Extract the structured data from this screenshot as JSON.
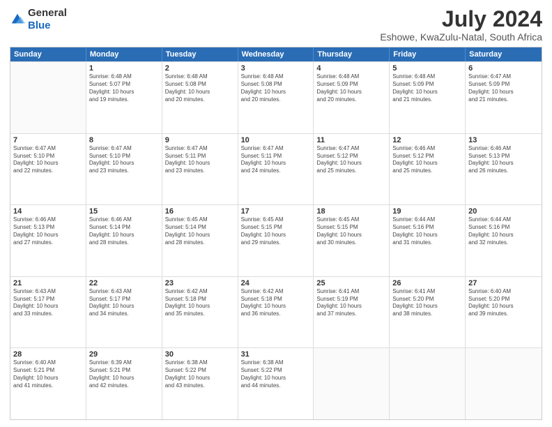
{
  "logo": {
    "general": "General",
    "blue": "Blue"
  },
  "title": "July 2024",
  "subtitle": "Eshowe, KwaZulu-Natal, South Africa",
  "days_of_week": [
    "Sunday",
    "Monday",
    "Tuesday",
    "Wednesday",
    "Thursday",
    "Friday",
    "Saturday"
  ],
  "weeks": [
    [
      {
        "day": "",
        "info": ""
      },
      {
        "day": "1",
        "info": "Sunrise: 6:48 AM\nSunset: 5:07 PM\nDaylight: 10 hours\nand 19 minutes."
      },
      {
        "day": "2",
        "info": "Sunrise: 6:48 AM\nSunset: 5:08 PM\nDaylight: 10 hours\nand 20 minutes."
      },
      {
        "day": "3",
        "info": "Sunrise: 6:48 AM\nSunset: 5:08 PM\nDaylight: 10 hours\nand 20 minutes."
      },
      {
        "day": "4",
        "info": "Sunrise: 6:48 AM\nSunset: 5:09 PM\nDaylight: 10 hours\nand 20 minutes."
      },
      {
        "day": "5",
        "info": "Sunrise: 6:48 AM\nSunset: 5:09 PM\nDaylight: 10 hours\nand 21 minutes."
      },
      {
        "day": "6",
        "info": "Sunrise: 6:47 AM\nSunset: 5:09 PM\nDaylight: 10 hours\nand 21 minutes."
      }
    ],
    [
      {
        "day": "7",
        "info": "Sunrise: 6:47 AM\nSunset: 5:10 PM\nDaylight: 10 hours\nand 22 minutes."
      },
      {
        "day": "8",
        "info": "Sunrise: 6:47 AM\nSunset: 5:10 PM\nDaylight: 10 hours\nand 23 minutes."
      },
      {
        "day": "9",
        "info": "Sunrise: 6:47 AM\nSunset: 5:11 PM\nDaylight: 10 hours\nand 23 minutes."
      },
      {
        "day": "10",
        "info": "Sunrise: 6:47 AM\nSunset: 5:11 PM\nDaylight: 10 hours\nand 24 minutes."
      },
      {
        "day": "11",
        "info": "Sunrise: 6:47 AM\nSunset: 5:12 PM\nDaylight: 10 hours\nand 25 minutes."
      },
      {
        "day": "12",
        "info": "Sunrise: 6:46 AM\nSunset: 5:12 PM\nDaylight: 10 hours\nand 25 minutes."
      },
      {
        "day": "13",
        "info": "Sunrise: 6:46 AM\nSunset: 5:13 PM\nDaylight: 10 hours\nand 26 minutes."
      }
    ],
    [
      {
        "day": "14",
        "info": "Sunrise: 6:46 AM\nSunset: 5:13 PM\nDaylight: 10 hours\nand 27 minutes."
      },
      {
        "day": "15",
        "info": "Sunrise: 6:46 AM\nSunset: 5:14 PM\nDaylight: 10 hours\nand 28 minutes."
      },
      {
        "day": "16",
        "info": "Sunrise: 6:45 AM\nSunset: 5:14 PM\nDaylight: 10 hours\nand 28 minutes."
      },
      {
        "day": "17",
        "info": "Sunrise: 6:45 AM\nSunset: 5:15 PM\nDaylight: 10 hours\nand 29 minutes."
      },
      {
        "day": "18",
        "info": "Sunrise: 6:45 AM\nSunset: 5:15 PM\nDaylight: 10 hours\nand 30 minutes."
      },
      {
        "day": "19",
        "info": "Sunrise: 6:44 AM\nSunset: 5:16 PM\nDaylight: 10 hours\nand 31 minutes."
      },
      {
        "day": "20",
        "info": "Sunrise: 6:44 AM\nSunset: 5:16 PM\nDaylight: 10 hours\nand 32 minutes."
      }
    ],
    [
      {
        "day": "21",
        "info": "Sunrise: 6:43 AM\nSunset: 5:17 PM\nDaylight: 10 hours\nand 33 minutes."
      },
      {
        "day": "22",
        "info": "Sunrise: 6:43 AM\nSunset: 5:17 PM\nDaylight: 10 hours\nand 34 minutes."
      },
      {
        "day": "23",
        "info": "Sunrise: 6:42 AM\nSunset: 5:18 PM\nDaylight: 10 hours\nand 35 minutes."
      },
      {
        "day": "24",
        "info": "Sunrise: 6:42 AM\nSunset: 5:18 PM\nDaylight: 10 hours\nand 36 minutes."
      },
      {
        "day": "25",
        "info": "Sunrise: 6:41 AM\nSunset: 5:19 PM\nDaylight: 10 hours\nand 37 minutes."
      },
      {
        "day": "26",
        "info": "Sunrise: 6:41 AM\nSunset: 5:20 PM\nDaylight: 10 hours\nand 38 minutes."
      },
      {
        "day": "27",
        "info": "Sunrise: 6:40 AM\nSunset: 5:20 PM\nDaylight: 10 hours\nand 39 minutes."
      }
    ],
    [
      {
        "day": "28",
        "info": "Sunrise: 6:40 AM\nSunset: 5:21 PM\nDaylight: 10 hours\nand 41 minutes."
      },
      {
        "day": "29",
        "info": "Sunrise: 6:39 AM\nSunset: 5:21 PM\nDaylight: 10 hours\nand 42 minutes."
      },
      {
        "day": "30",
        "info": "Sunrise: 6:38 AM\nSunset: 5:22 PM\nDaylight: 10 hours\nand 43 minutes."
      },
      {
        "day": "31",
        "info": "Sunrise: 6:38 AM\nSunset: 5:22 PM\nDaylight: 10 hours\nand 44 minutes."
      },
      {
        "day": "",
        "info": ""
      },
      {
        "day": "",
        "info": ""
      },
      {
        "day": "",
        "info": ""
      }
    ]
  ]
}
